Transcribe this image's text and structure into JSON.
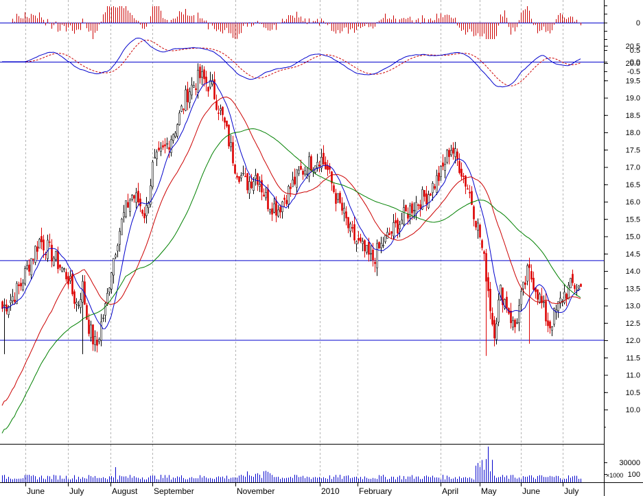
{
  "chart_data": [
    {
      "type": "bar",
      "panel": "oscillator-histogram",
      "ytick_labels": [
        "0"
      ],
      "color": "#cc0000"
    },
    {
      "type": "line",
      "panel": "macd",
      "ytick_labels": [
        "0.5",
        "0.0",
        "-0.5"
      ],
      "series": [
        {
          "color": "#0000cc"
        },
        {
          "color": "#cc0000",
          "dashed": true
        }
      ],
      "zero_line_color": "#0000cc"
    },
    {
      "type": "candlestick",
      "panel": "price",
      "ylim": [
        9.6,
        20.8
      ],
      "yticks": [
        10.0,
        10.5,
        11.0,
        11.5,
        12.0,
        12.5,
        13.0,
        13.5,
        14.0,
        14.5,
        15.0,
        15.5,
        16.0,
        16.5,
        17.0,
        17.5,
        18.0,
        18.5,
        19.0,
        19.5,
        20.0,
        20.5
      ],
      "ytick_labels": [
        "10.0",
        "10.5",
        "11.0",
        "11.5",
        "12.0",
        "12.5",
        "13.0",
        "13.5",
        "14.0",
        "14.5",
        "15.0",
        "15.5",
        "16.0",
        "16.5",
        "17.0",
        "17.5",
        "18.0",
        "18.5",
        "19.0",
        "19.5",
        "20.0",
        "20.5"
      ],
      "horizontal_lines": [
        14.3,
        12.0
      ],
      "up_color": "#000000",
      "down_color": "#dd0000",
      "moving_averages": [
        {
          "color": "#0000cc",
          "role": "short"
        },
        {
          "color": "#cc0000",
          "role": "medium"
        },
        {
          "color": "#008000",
          "role": "long"
        }
      ],
      "close_path_months": [
        "June",
        "July",
        "August",
        "September",
        "November",
        "2010",
        "February",
        "April",
        "May",
        "June",
        "July"
      ],
      "close_path_values": [
        [
          12.9,
          13.2,
          13.6,
          14.3,
          14.9,
          14.6,
          14.2
        ],
        [
          13.8,
          13.3,
          13.0,
          13.6,
          12.6,
          12.1,
          11.8,
          12.5,
          13.0
        ],
        [
          14.0,
          15.0,
          15.7,
          16.2,
          16.0,
          15.6
        ],
        [
          17.0,
          17.5,
          18.2,
          19.2,
          19.6,
          19.3,
          18.3
        ],
        [
          17.0,
          16.5,
          16.8,
          16.0,
          15.8,
          16.3,
          16.8,
          17.1
        ],
        [
          17.3,
          16.9,
          16.2,
          15.7,
          15.1
        ],
        [
          14.8,
          14.3,
          14.9,
          15.4,
          15.9,
          16.2
        ],
        [
          16.8,
          17.6,
          17.0,
          16.2
        ],
        [
          15.0,
          13.8,
          12.2,
          13.4,
          13.0,
          12.3
        ],
        [
          13.2,
          14.0,
          13.6,
          13.0,
          12.4,
          12.8
        ],
        [
          13.3,
          13.6
        ]
      ],
      "x_dates": [
        "June",
        "July",
        "August",
        "September",
        "November",
        "2010",
        "February",
        "April",
        "May",
        "June",
        "July"
      ]
    },
    {
      "type": "bar",
      "panel": "volume",
      "ytick_labels": [
        "30000",
        "100"
      ],
      "unit_label": "×1000",
      "color": "#0000cc"
    }
  ],
  "x_axis": {
    "labels": [
      "June",
      "July",
      "August",
      "September",
      "November",
      "2010",
      "February",
      "April",
      "May",
      "June",
      "July"
    ]
  }
}
